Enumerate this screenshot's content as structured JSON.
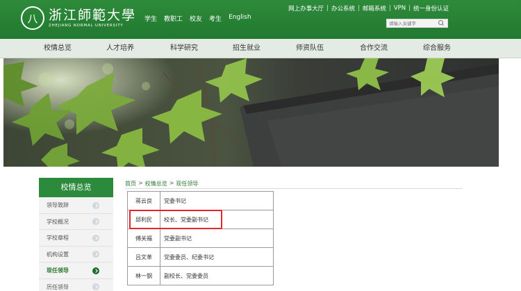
{
  "header": {
    "logo": {
      "seal_char": "八",
      "name_cn": "浙江師範大學",
      "name_en": "ZHEJIANG NORMAL UNIVERSITY"
    },
    "top_nav": [
      "学生",
      "教职工",
      "校友",
      "考生",
      "English"
    ],
    "util_links": [
      "网上办事大厅",
      "办公系统",
      "邮箱系统",
      "VPN",
      "统一身份认证"
    ],
    "search": {
      "placeholder": "请输入关键字"
    }
  },
  "main_nav": [
    "校情总览",
    "人才培养",
    "科学研究",
    "招生就业",
    "师资队伍",
    "合作交流",
    "综合服务"
  ],
  "sidebar": {
    "title": "校情总览",
    "items": [
      {
        "label": "领导致辞",
        "active": false
      },
      {
        "label": "学校概况",
        "active": false
      },
      {
        "label": "学校章程",
        "active": false
      },
      {
        "label": "机构设置",
        "active": false
      },
      {
        "label": "现任领导",
        "active": true
      },
      {
        "label": "历任领导",
        "active": false
      }
    ]
  },
  "breadcrumb": [
    "首页",
    "校情总览",
    "现任领导"
  ],
  "leaders": [
    {
      "name": "蒋云良",
      "title": "党委书记"
    },
    {
      "name": "邱利民",
      "title": "校长、党委副书记"
    },
    {
      "name": "傅关福",
      "title": "党委副书记"
    },
    {
      "name": "吕文革",
      "title": "党委委员、纪委书记"
    },
    {
      "name": "林一钢",
      "title": "副校长、党委委员"
    }
  ],
  "colors": {
    "header_green": "#217a2f",
    "accent_green": "#2b8a3b",
    "highlight_red": "#e3262a"
  }
}
